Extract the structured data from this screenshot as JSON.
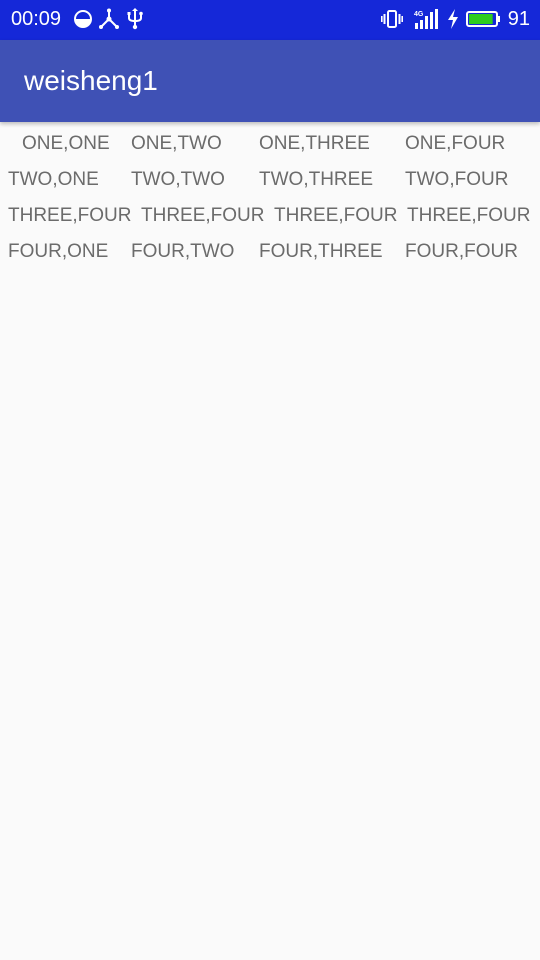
{
  "status_bar": {
    "time": "00:09",
    "battery_level": "91",
    "icons": [
      "data-saver-icon",
      "usb-tethering-icon",
      "usb-icon",
      "vibrate-icon",
      "4g-signal-icon",
      "charging-icon",
      "battery-icon"
    ]
  },
  "app_bar": {
    "title": "weisheng1"
  },
  "grid": {
    "rows": [
      [
        "ONE,ONE",
        "ONE,TWO",
        "ONE,THREE",
        "ONE,FOUR"
      ],
      [
        "TWO,ONE",
        "TWO,TWO",
        "TWO,THREE",
        "TWO,FOUR"
      ],
      [
        "THREE,FOUR",
        "THREE,FOUR",
        "THREE,FOUR",
        "THREE,FOUR"
      ],
      [
        "FOUR,ONE",
        "FOUR,TWO",
        "FOUR,THREE",
        "FOUR,FOUR"
      ]
    ]
  },
  "colors": {
    "status_bar_bg": "#1528d8",
    "app_bar_bg": "#3f51b5",
    "page_bg": "#fafafa",
    "cell_text": "#6b6b6b",
    "battery_fill": "#2ecc1e"
  }
}
